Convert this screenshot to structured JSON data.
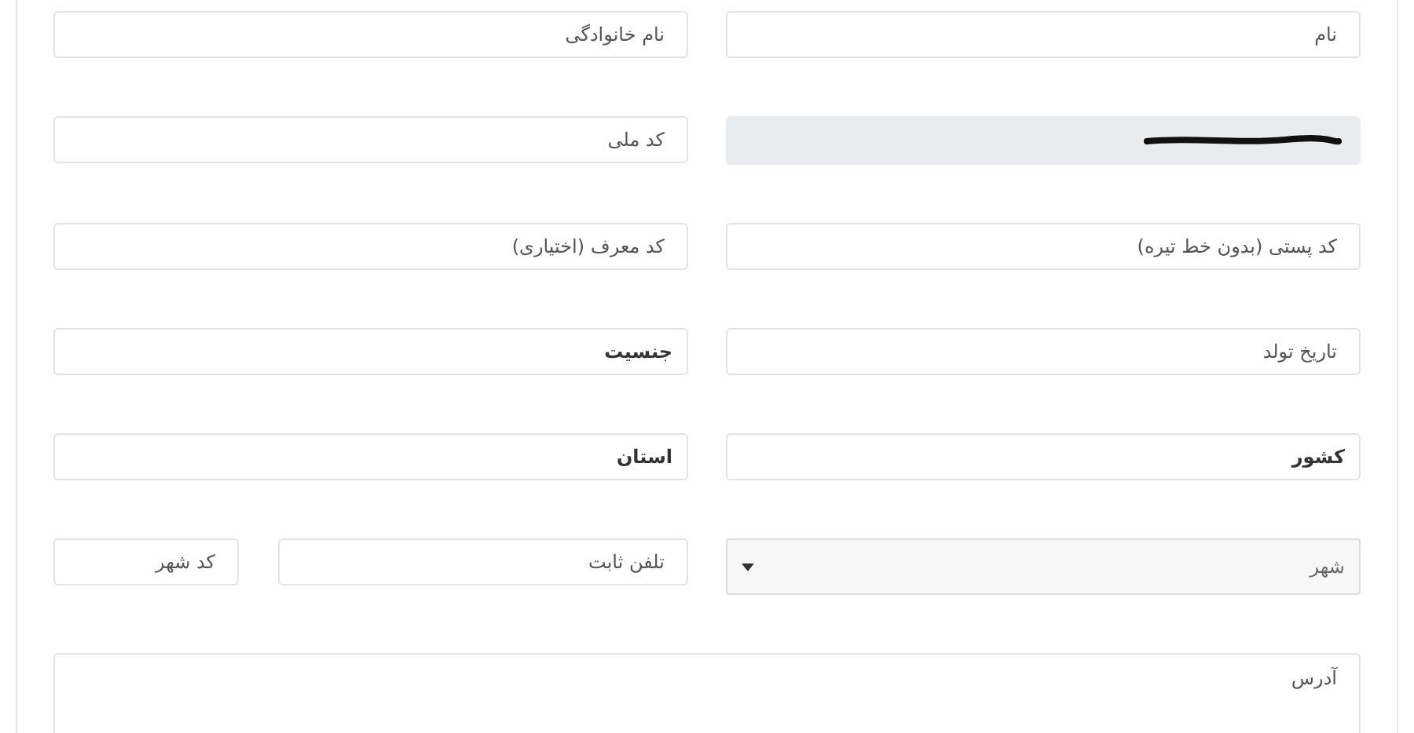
{
  "rows": [
    {
      "fields": [
        {
          "kind": "input",
          "placeholder": "نام",
          "disabled": false
        },
        {
          "kind": "input",
          "placeholder": "نام خانوادگی",
          "disabled": false
        }
      ]
    },
    {
      "fields": [
        {
          "kind": "redacted",
          "disabled": true
        },
        {
          "kind": "input",
          "placeholder": "کد ملی",
          "disabled": false
        }
      ]
    },
    {
      "fields": [
        {
          "kind": "input",
          "placeholder": "کد پستی (بدون خط تیره)",
          "disabled": false
        },
        {
          "kind": "input",
          "placeholder": "کد معرف (اختیاری)",
          "disabled": false
        }
      ]
    },
    {
      "fields": [
        {
          "kind": "input",
          "placeholder": "تاریخ تولد",
          "disabled": false
        },
        {
          "kind": "select",
          "value": "جنسیت",
          "disabled": false
        }
      ]
    },
    {
      "fields": [
        {
          "kind": "select",
          "value": "کشور",
          "disabled": false
        },
        {
          "kind": "select",
          "value": "استان",
          "disabled": false
        }
      ]
    },
    {
      "fields": [
        {
          "kind": "dropdown",
          "placeholder": "شهر",
          "disabled": false
        },
        {
          "kind": "pair",
          "parts": [
            {
              "placeholder": "تلفن ثابت"
            },
            {
              "placeholder": "کد شهر"
            }
          ]
        }
      ]
    }
  ],
  "address": {
    "placeholder": "آدرس"
  }
}
